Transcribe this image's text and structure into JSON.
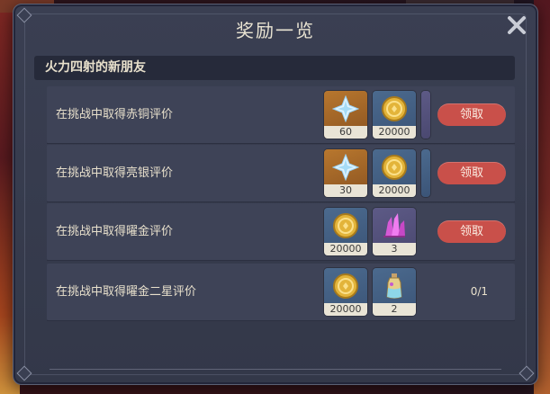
{
  "dialog": {
    "title": "奖励一览",
    "close_icon": "close-x-icon"
  },
  "section": {
    "title": "火力四射的新朋友"
  },
  "colors": {
    "claim_button": "#c9504a",
    "panel": "#3a3f52",
    "row": "#3e4357"
  },
  "rows": [
    {
      "label": "在挑战中取得赤铜评价",
      "items": [
        {
          "icon": "primogem-icon",
          "quantity": "60",
          "frame": "gold"
        },
        {
          "icon": "mora-coin-icon",
          "quantity": "20000",
          "frame": "blue"
        }
      ],
      "action": "领取"
    },
    {
      "label": "在挑战中取得亮银评价",
      "items": [
        {
          "icon": "primogem-icon",
          "quantity": "30",
          "frame": "gold"
        },
        {
          "icon": "mora-coin-icon",
          "quantity": "20000",
          "frame": "blue"
        }
      ],
      "action": "领取"
    },
    {
      "label": "在挑战中取得曜金评价",
      "items": [
        {
          "icon": "mora-coin-icon",
          "quantity": "20000",
          "frame": "blue"
        },
        {
          "icon": "crystal-ore-icon",
          "quantity": "3",
          "frame": "purple"
        }
      ],
      "action": "领取"
    },
    {
      "label": "在挑战中取得曜金二星评价",
      "items": [
        {
          "icon": "mora-coin-icon",
          "quantity": "20000",
          "frame": "blue"
        },
        {
          "icon": "potion-bottle-icon",
          "quantity": "2",
          "frame": "blue"
        }
      ],
      "progress": "0/1"
    }
  ]
}
